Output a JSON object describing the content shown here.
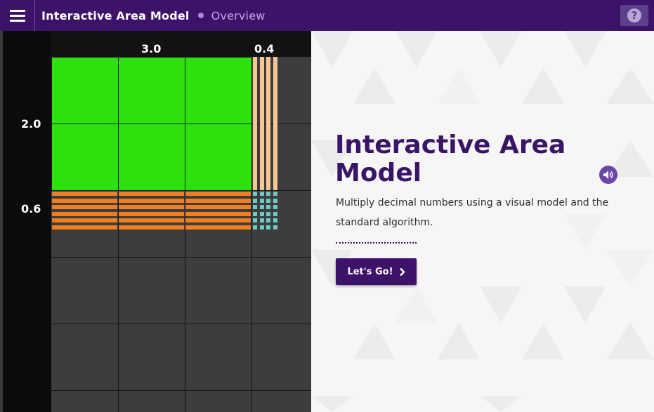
{
  "header": {
    "app_title": "Interactive Area Model",
    "section": "Overview",
    "menu_icon": "hamburger-menu-icon",
    "help_icon": "question-mark-icon",
    "help_glyph": "?"
  },
  "model": {
    "top_labels": [
      "3.0",
      "0.4"
    ],
    "side_labels": [
      "2.0",
      "0.6"
    ],
    "colors": {
      "ones": "#2ee00c",
      "tenths_vertical": "#f6c793",
      "tenths_horizontal": "#f07f23",
      "hundredths": "#6ccbc6",
      "empty_grid": "#3d3d3d"
    }
  },
  "intro": {
    "title": "Interactive Area Model",
    "description": "Multiply decimal numbers using a visual model and the standard algorithm.",
    "audio_icon": "speaker-icon",
    "button_label": "Let's Go!",
    "button_icon": "chevron-right-icon"
  },
  "theme": {
    "brand_purple": "#3d1269",
    "accent_lilac": "#bfa7e8"
  }
}
